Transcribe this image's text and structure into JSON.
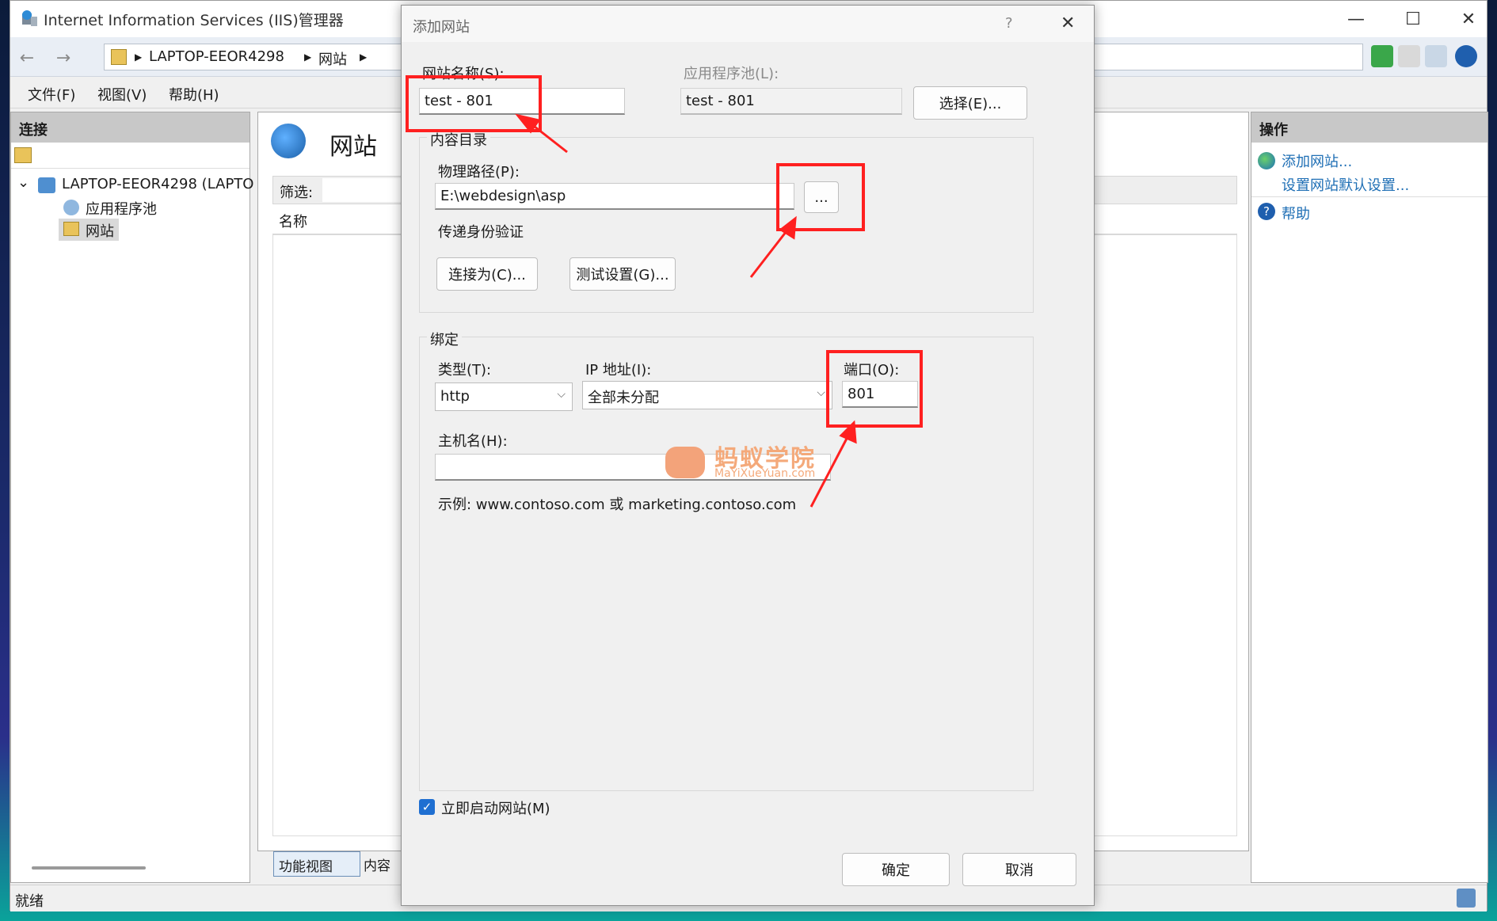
{
  "iis": {
    "title": "Internet Information Services (IIS)管理器",
    "window_controls": {
      "minimize": "—",
      "maximize": "☐",
      "close": "✕"
    },
    "breadcrumb": [
      "LAPTOP-EEOR4298",
      "网站"
    ],
    "menu": [
      "文件(F)",
      "视图(V)",
      "帮助(H)"
    ],
    "connections": {
      "title": "连接",
      "tree": [
        {
          "label": "LAPTOP-EEOR4298 (LAPTO"
        },
        {
          "label": "应用程序池"
        },
        {
          "label": "网站"
        }
      ]
    },
    "content": {
      "title": "网站",
      "filter_label": "筛选:",
      "column_name": "名称"
    },
    "actions": {
      "title": "操作",
      "items": [
        "添加网站...",
        "设置网站默认设置...",
        "帮助"
      ]
    },
    "bottom_tabs": [
      "功能视图",
      "内容"
    ],
    "status": "就绪"
  },
  "dialog": {
    "title": "添加网站",
    "help": "?",
    "close": "✕",
    "site_name_label": "网站名称(S):",
    "site_name_value": "test - 801",
    "app_pool_label": "应用程序池(L):",
    "app_pool_value": "test - 801",
    "select_button": "选择(E)...",
    "content_dir_label": "内容目录",
    "physical_path_label": "物理路径(P):",
    "physical_path_value": "E:\\webdesign\\asp",
    "browse_button": "...",
    "pass_auth_label": "传递身份验证",
    "connect_as_button": "连接为(C)...",
    "test_settings_button": "测试设置(G)...",
    "binding_label": "绑定",
    "type_label": "类型(T):",
    "type_value": "http",
    "ip_label": "IP 地址(I):",
    "ip_value": "全部未分配",
    "port_label": "端口(O):",
    "port_value": "801",
    "host_label": "主机名(H):",
    "host_value": "",
    "example_text": "示例: www.contoso.com 或 marketing.contoso.com",
    "start_immediately_label": "立即启动网站(M)",
    "start_immediately_checked": true,
    "ok_button": "确定",
    "cancel_button": "取消"
  },
  "watermark": {
    "cn": "蚂蚁学院",
    "en": "MaYiXueYuan.com"
  },
  "colors": {
    "annotation": "#ff2020",
    "accent": "#1f6fd1",
    "link": "#1f6fb5"
  }
}
